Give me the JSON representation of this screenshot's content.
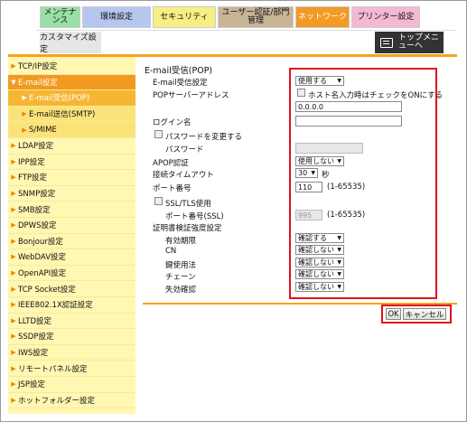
{
  "tabs": {
    "maintenance": "メンテナンス",
    "environment": "環境設定",
    "security": "セキュリティ",
    "user_auth_l1": "ユーザー認証/部門",
    "user_auth_l2": "管理",
    "network": "ネットワーク",
    "printer": "プリンター設定",
    "customize": "カスタマイズ設定",
    "top_menu": "トップメニューへ"
  },
  "sidebar": {
    "items": [
      {
        "label": "TCP/IP設定"
      },
      {
        "label": "E-mail設定"
      },
      {
        "label": "E-mail受信(POP)"
      },
      {
        "label": "E-mail送信(SMTP)"
      },
      {
        "label": "S/MIME"
      },
      {
        "label": "LDAP設定"
      },
      {
        "label": "IPP設定"
      },
      {
        "label": "FTP設定"
      },
      {
        "label": "SNMP設定"
      },
      {
        "label": "SMB設定"
      },
      {
        "label": "DPWS設定"
      },
      {
        "label": "Bonjour設定"
      },
      {
        "label": "WebDAV設定"
      },
      {
        "label": "OpenAPI設定"
      },
      {
        "label": "TCP Socket設定"
      },
      {
        "label": "IEEE802.1X認証設定"
      },
      {
        "label": "LLTD設定"
      },
      {
        "label": "SSDP設定"
      },
      {
        "label": "IWS設定"
      },
      {
        "label": "リモートパネル設定"
      },
      {
        "label": "JSP設定"
      },
      {
        "label": "ホットフォルダー設定"
      }
    ]
  },
  "form": {
    "title": "E-mail受信(POP)",
    "email_recv_label": "E-mail受信設定",
    "email_recv_value": "使用する",
    "pop_server_label": "POPサーバーアドレス",
    "host_name_check": "ホスト名入力時はチェックをONにする",
    "pop_server_value": "0.0.0.0",
    "login_label": "ログイン名",
    "login_value": "",
    "change_password_label": "パスワードを変更する",
    "password_label": "パスワード",
    "apop_label": "APOP認証",
    "apop_value": "使用しない",
    "timeout_label": "接続タイムアウト",
    "timeout_value": "30",
    "timeout_unit": "秒",
    "port_label": "ポート番号",
    "port_value": "110",
    "port_range": "(1-65535)",
    "ssl_label": "SSL/TLS使用",
    "ssl_port_label": "ポート番号(SSL)",
    "ssl_port_value": "995",
    "ssl_port_range": "(1-65535)",
    "cert_label": "証明書検証強度設定",
    "validity_label": "有効期限",
    "validity_value": "確認する",
    "cn_label": "CN",
    "cn_value": "確認しない",
    "key_usage_label": "鍵使用法",
    "key_usage_value": "確認しない",
    "chain_label": "チェーン",
    "chain_value": "確認しない",
    "expiry_label": "失効確認",
    "expiry_value": "確認しない"
  },
  "buttons": {
    "ok": "OK",
    "cancel": "キャンセル"
  },
  "colors": {
    "accent": "#f39a24",
    "highlight_box": "#e0101e",
    "sidebar_bg": "#fff7b2"
  }
}
